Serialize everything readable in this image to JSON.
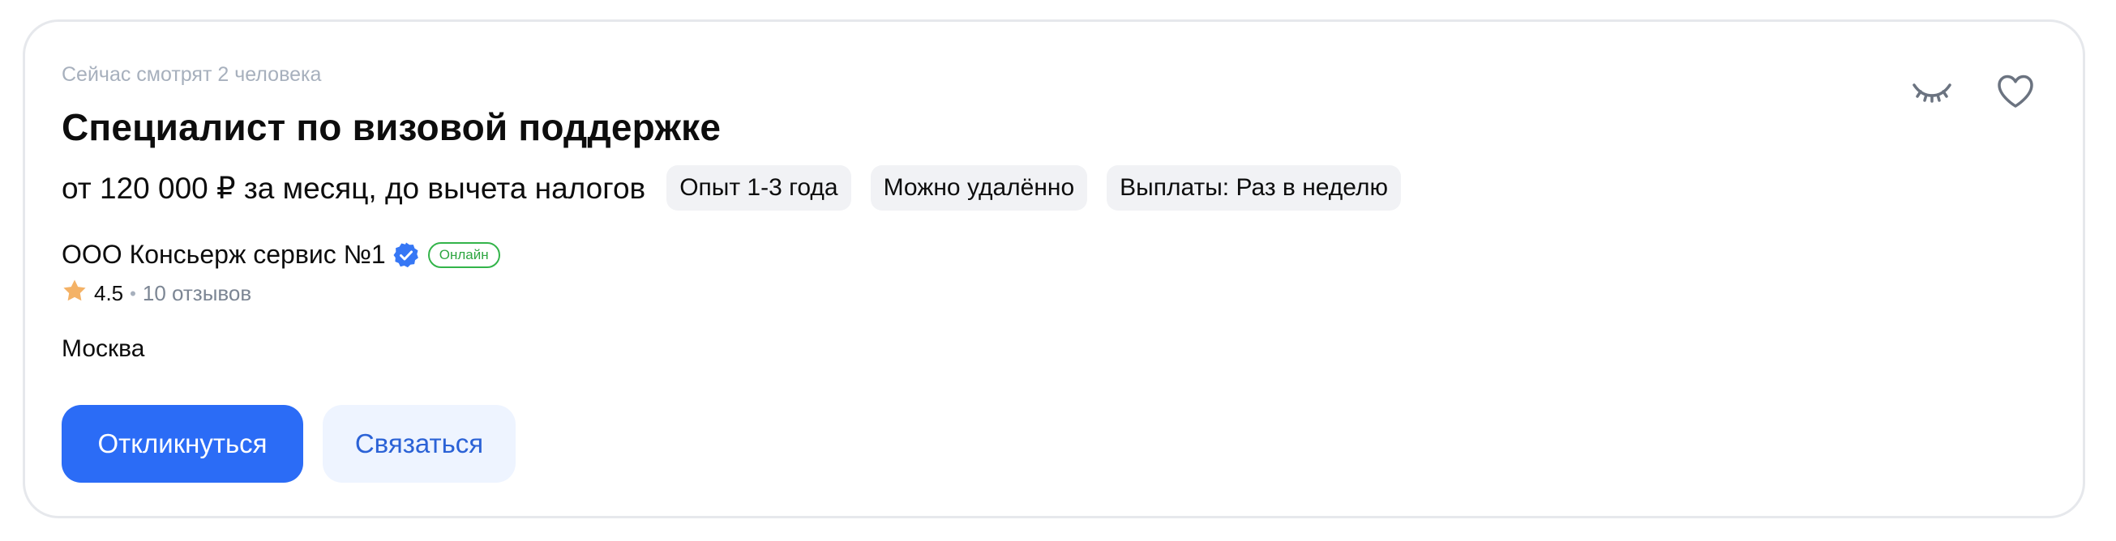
{
  "card": {
    "watchers_text": "Сейчас смотрят 2 человека",
    "title": "Специалист по визовой поддержке",
    "salary": "от 120 000 ₽ за месяц, до вычета налогов",
    "chips": [
      "Опыт 1-3 года",
      "Можно удалённо",
      "Выплаты: Раз в неделю"
    ],
    "company": "ООО Консьерж сервис №1",
    "online_badge": "Онлайн",
    "rating": "4.5",
    "reviews": "10 отзывов",
    "city": "Москва",
    "buttons": {
      "respond": "Откликнуться",
      "contact": "Связаться"
    },
    "icons": {
      "hide": "closed-eye-icon",
      "favorite": "heart-icon",
      "verified": "verified-check-icon",
      "star": "star-icon"
    },
    "colors": {
      "primary": "#2b6cf6",
      "secondary_bg": "#eef4ff",
      "online": "#33b44a",
      "star": "#f4b266",
      "chip_bg": "#f1f2f5"
    }
  }
}
